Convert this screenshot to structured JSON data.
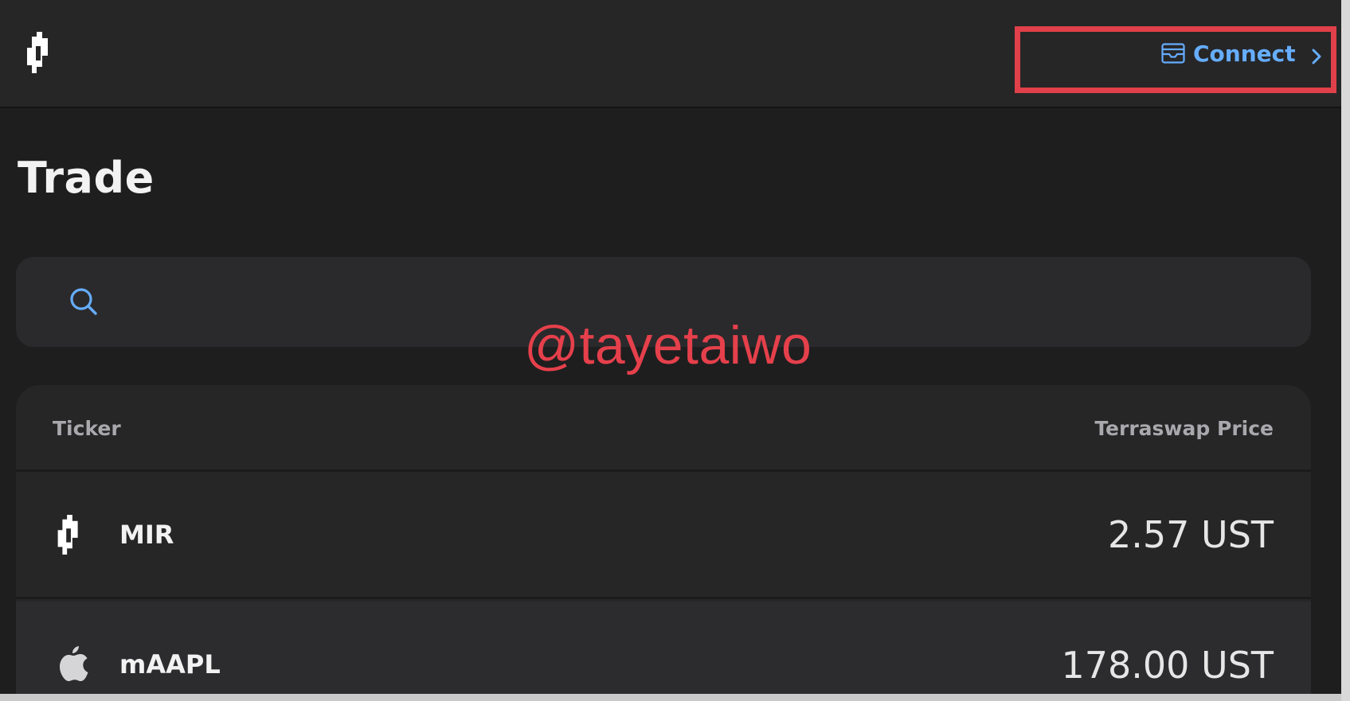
{
  "header": {
    "logo_icon": "mirror-logo-icon",
    "connect_label": "Connect",
    "connect_icon": "wallet-icon",
    "connect_chevron": "chevron-right-icon",
    "accent_color": "#66adff",
    "highlight_color": "#e0404a"
  },
  "page": {
    "title": "Trade"
  },
  "search": {
    "icon": "search-icon",
    "value": "",
    "placeholder": ""
  },
  "watermark": {
    "text": "@tayetaiwo",
    "color": "#e5404b"
  },
  "table": {
    "columns": [
      "Ticker",
      "Terraswap Price"
    ],
    "rows": [
      {
        "icon": "mirror-logo-icon",
        "ticker": "MIR",
        "price": "2.57 UST"
      },
      {
        "icon": "apple-icon",
        "ticker": "mAAPL",
        "price": "178.00 UST"
      }
    ]
  }
}
